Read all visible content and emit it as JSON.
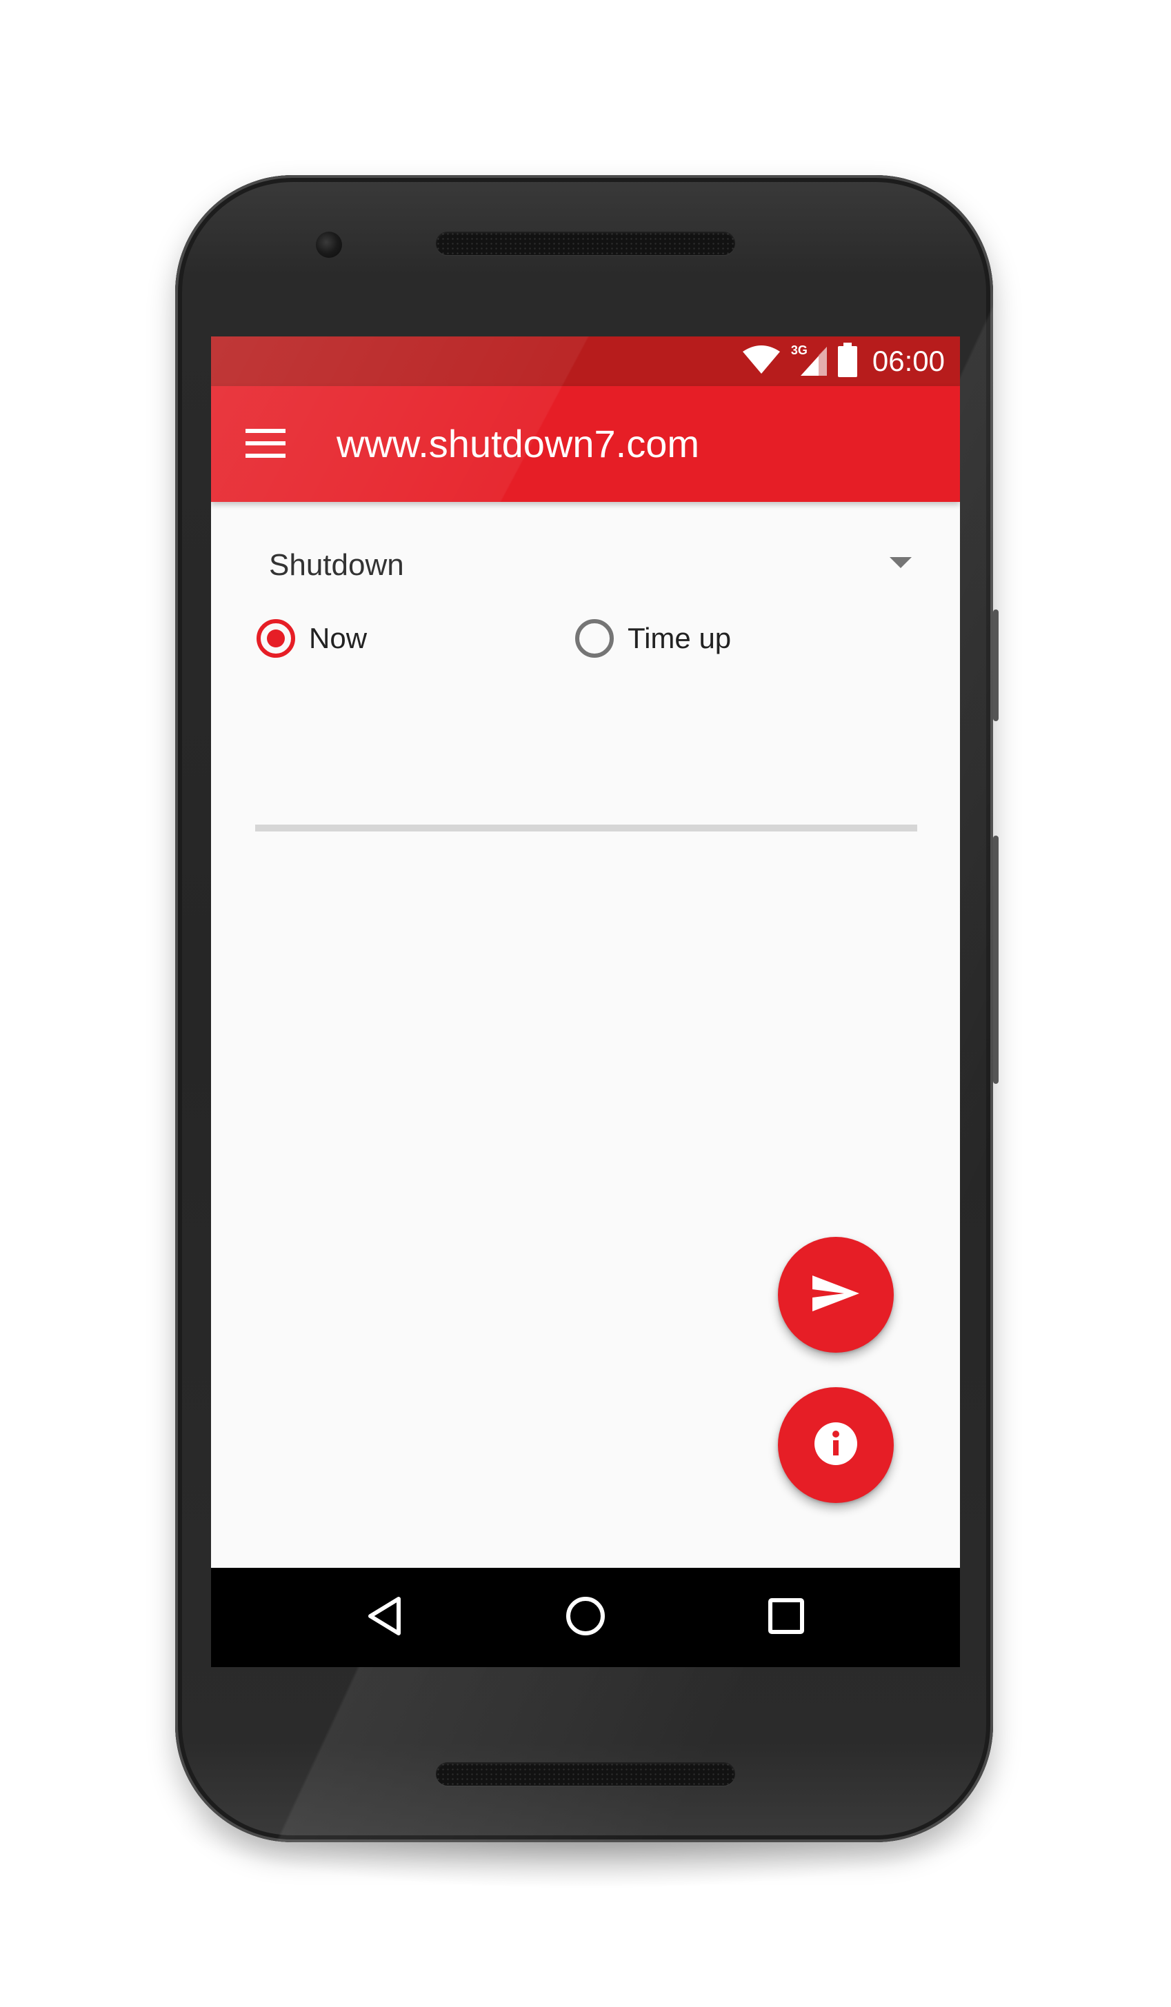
{
  "status_bar": {
    "network_label": "3G",
    "time": "06:00",
    "icons": [
      "wifi-icon",
      "cellular-signal-icon",
      "battery-icon"
    ]
  },
  "app_bar": {
    "title": "www.shutdown7.com",
    "menu_icon": "hamburger-menu-icon"
  },
  "action_spinner": {
    "selected": "Shutdown"
  },
  "timing_options": [
    {
      "label": "Now",
      "selected": true
    },
    {
      "label": "Time up",
      "selected": false
    }
  ],
  "fabs": [
    {
      "icon": "send-icon"
    },
    {
      "icon": "info-icon"
    }
  ],
  "nav_bar": {
    "buttons": [
      "back-icon",
      "home-icon",
      "recents-icon"
    ]
  },
  "colors": {
    "status_bar": "#b71c1c",
    "primary": "#e61e26",
    "background": "#fafafa",
    "nav_bar": "#000000"
  }
}
